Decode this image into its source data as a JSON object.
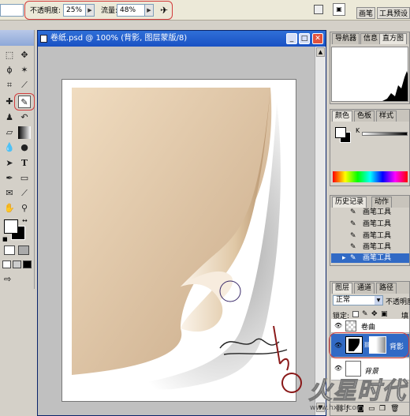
{
  "options_bar": {
    "opacity_label": "不透明度:",
    "opacity_value": "25%",
    "flow_label": "流量:",
    "flow_value": "48%",
    "palette_tab_brushes": "画笔",
    "palette_tab_tool_presets": "工具预设"
  },
  "document": {
    "title": "卷纸.psd @ 100% (背影, 图层蒙版/8)"
  },
  "navigator_panel": {
    "tabs": [
      "导航器",
      "信息",
      "直方图"
    ]
  },
  "color_panel": {
    "tabs": [
      "颜色",
      "色板",
      "样式"
    ],
    "k_label": "K"
  },
  "history_panel": {
    "tabs": [
      "历史记录",
      "动作"
    ],
    "items": [
      "画笔工具",
      "画笔工具",
      "画笔工具",
      "画笔工具",
      "画笔工具"
    ]
  },
  "layers_panel": {
    "tabs": [
      "图层",
      "通道",
      "路径"
    ],
    "blend_mode": "正常",
    "opacity_label": "不透明度",
    "lock_label": "锁定:",
    "fill_label": "填",
    "layers": [
      {
        "name": "卷曲"
      },
      {
        "name": "背影"
      },
      {
        "name": "背景"
      }
    ]
  },
  "watermark": {
    "logo_text": "火星时代",
    "url": "www.hxsd.com"
  },
  "colors": {
    "title_bar": "#1951c4",
    "paper_light": "#f0dcc0",
    "paper_dark": "#c9aa88",
    "selection_blue": "#316ac5",
    "highlight_red": "#d23c3c"
  }
}
